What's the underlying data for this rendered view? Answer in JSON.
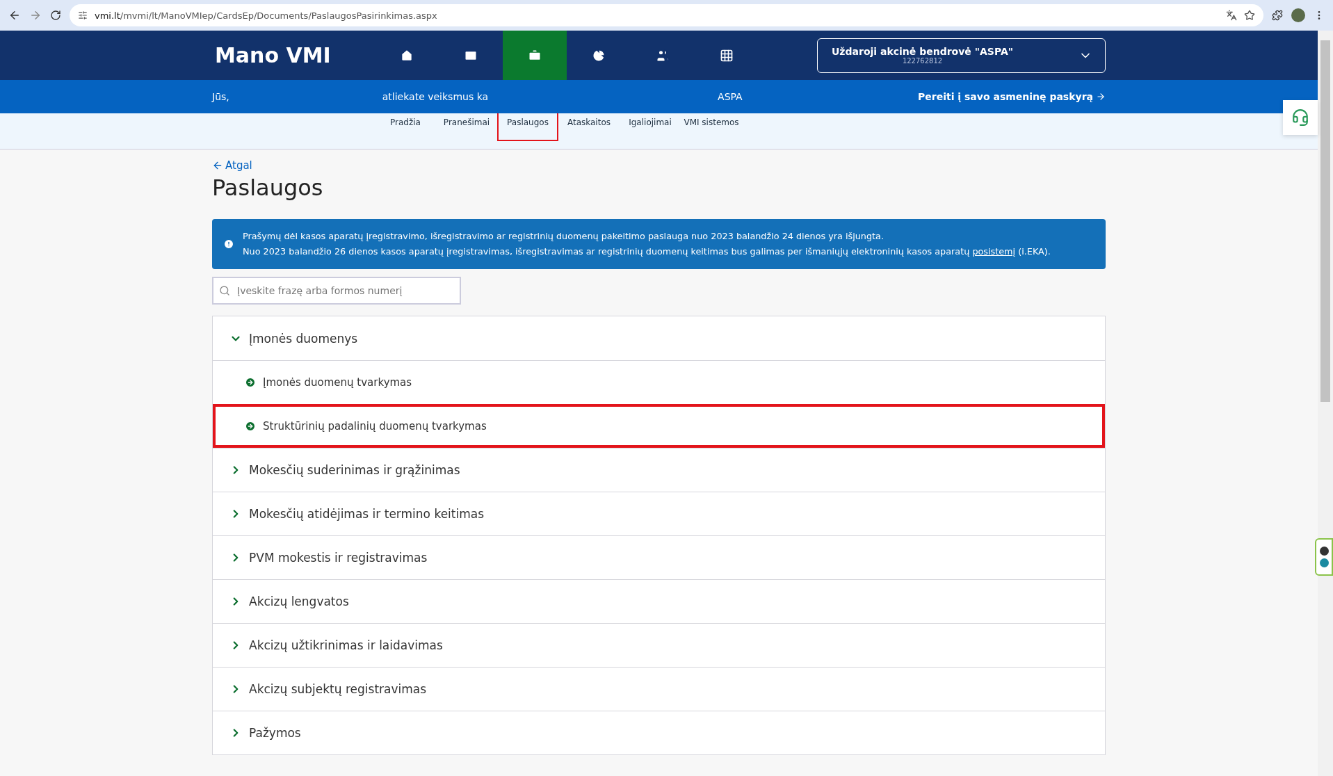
{
  "browser": {
    "url_host": "vmi.lt",
    "url_path": "/mvmi/lt/ManoVMIep/CardsEp/Documents/PaslaugosPasirinkimas.aspx"
  },
  "header": {
    "logo": "Mano VMI",
    "account": {
      "name": "Uždaroji akcinė bendrovė  \"ASPA\"",
      "code": "122762812"
    },
    "nav": [
      {
        "kind": "home",
        "label": "Pradžia",
        "selected": false,
        "highlighted": false
      },
      {
        "kind": "mail",
        "label": "Pranešimai",
        "selected": false,
        "highlighted": false
      },
      {
        "kind": "briefcase",
        "label": "Paslaugos",
        "selected": true,
        "highlighted": true
      },
      {
        "kind": "chart",
        "label": "Ataskaitos",
        "selected": false,
        "highlighted": false
      },
      {
        "kind": "people",
        "label": "Igaliojimai",
        "selected": false,
        "highlighted": false
      },
      {
        "kind": "grid",
        "label": "VMI sistemos",
        "selected": false,
        "highlighted": false
      }
    ],
    "subbar": {
      "texts": [
        "Jūs,",
        "atliekate veiksmus ka",
        "ASPA"
      ],
      "personal_link": "Pereiti į savo asmeninę paskyrą"
    }
  },
  "back": "Atgal",
  "title": "Paslaugos",
  "notice": {
    "line1": "Prašymų dėl kasos aparatų įregistravimo, išregistravimo ar registrinių duomenų pakeitimo paslauga nuo 2023 balandžio 24 dienos yra išjungta.",
    "line2_before": "Nuo 2023 balandžio 26 dienos kasos aparatų įregistravimas, išregistravimas ar registrinių duomenų keitimas bus galimas per išmaniųjų elektroninių kasos aparatų",
    "link": "posistemį",
    "line2_after": "(i.EKA)."
  },
  "search": {
    "placeholder": "Įveskite frazę arba formos numerį"
  },
  "sections": [
    {
      "label": "Įmonės duomenys",
      "expanded": true,
      "children": [
        {
          "label": "Įmonės duomenų tvarkymas",
          "highlighted": false
        },
        {
          "label": "Struktūrinių padalinių duomenų tvarkymas",
          "highlighted": true
        }
      ]
    },
    {
      "label": "Mokesčių suderinimas ir grąžinimas",
      "expanded": false
    },
    {
      "label": "Mokesčių atidėjimas ir termino keitimas",
      "expanded": false
    },
    {
      "label": "PVM mokestis ir registravimas",
      "expanded": false
    },
    {
      "label": "Akcizų lengvatos",
      "expanded": false
    },
    {
      "label": "Akcizų užtikrinimas ir laidavimas",
      "expanded": false
    },
    {
      "label": "Akcizų subjektų registravimas",
      "expanded": false
    },
    {
      "label": "Pažymos",
      "expanded": false
    }
  ]
}
